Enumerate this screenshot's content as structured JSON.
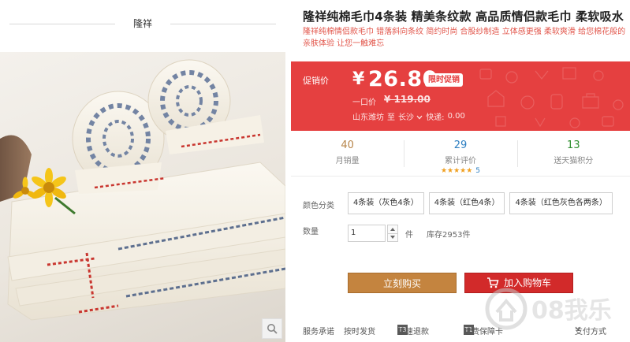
{
  "brand": {
    "name": "隆祥"
  },
  "product": {
    "title": "隆祥纯棉毛巾4条装 精美条纹款 高品质情侣款毛巾 柔软吸水",
    "subtitle": "隆祥纯棉情侣款毛巾 错落斜向条纹 简约时尚 合股纱制造 立体感更强 柔软爽滑 给您棉花般的亲肤体验 让您一触难忘"
  },
  "price": {
    "promo_label": "促销价",
    "currency": "¥",
    "value": "26.80",
    "promo_tag": "限时促销",
    "original_label": "一口价",
    "original_value": "¥ 119.00"
  },
  "shipping": {
    "origin": "山东潍坊",
    "to_label": "至",
    "destination": "长沙",
    "fee_label": "快递:",
    "fee": "0.00"
  },
  "stats": {
    "monthly_sales": {
      "value": "40",
      "label": "月销量"
    },
    "reviews": {
      "value": "29",
      "label": "累计评价",
      "stars": "★★★★★",
      "rating": "5"
    },
    "points": {
      "value": "13",
      "label": "送天猫积分"
    }
  },
  "options": {
    "color_label": "颜色分类",
    "colors": [
      "4条装（灰色4条）",
      "4条装（红色4条）",
      "4条装（红色灰色各两条）"
    ]
  },
  "quantity": {
    "label": "数量",
    "value": "1",
    "unit": "件",
    "stock": "库存2953件"
  },
  "actions": {
    "buy_now": "立刻购买",
    "add_to_cart": "加入购物车"
  },
  "service": {
    "label": "服务承诺",
    "items": [
      "按时发货",
      "极速退款",
      "运费保障卡"
    ],
    "badges": [
      "T3",
      "T1"
    ],
    "payment": "支付方式"
  },
  "watermark": {
    "text": "08我乐"
  },
  "colors": {
    "price_red": "#e54040",
    "buy_orange": "#c4843f",
    "cart_red": "#d22a2a",
    "subtitle_red": "#e2564b"
  }
}
